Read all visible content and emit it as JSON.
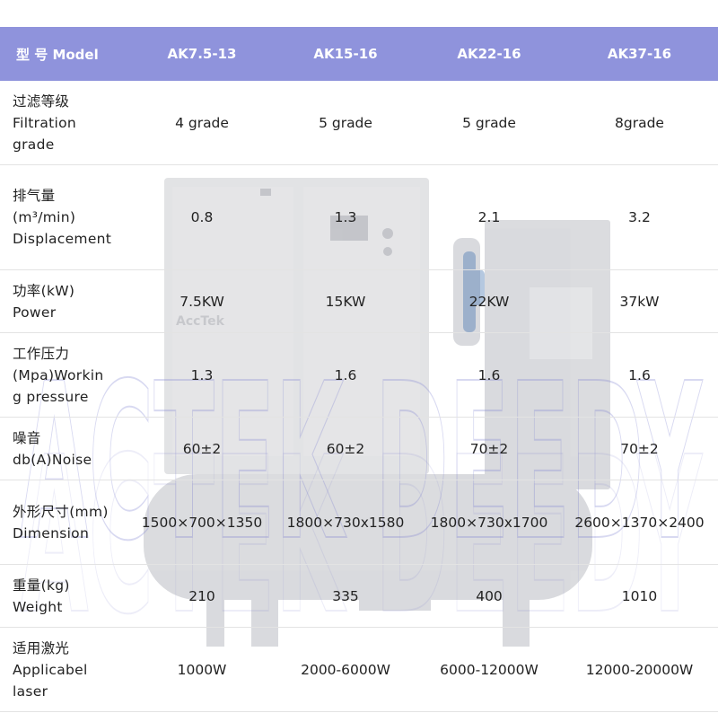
{
  "header": {
    "label": "型 号 Model",
    "models": [
      "AK7.5-13",
      "AK15-16",
      "AK22-16",
      "AK37-16"
    ]
  },
  "rows": [
    {
      "label": "过滤等级\nFiltration\ngrade",
      "values": [
        "4 grade",
        "5 grade",
        "5 grade",
        "8grade"
      ]
    },
    {
      "label": "排气量\n(m³/min)\nDisplacement",
      "values": [
        "0.8",
        "1.3",
        "2.1",
        "3.2"
      ]
    },
    {
      "label": "功率(kW)\nPower",
      "values": [
        "7.5KW",
        "15KW",
        "22KW",
        "37kW"
      ]
    },
    {
      "label": "工作压力\n(Mpa)Workin\ng pressure",
      "values": [
        "1.3",
        "1.6",
        "1.6",
        "1.6"
      ]
    },
    {
      "label": "噪音\ndb(A)Noise",
      "values": [
        "60±2",
        "60±2",
        "70±2",
        "70±2"
      ]
    },
    {
      "label": "外形尺寸(mm)\nDimension",
      "values": [
        "1500×700×1350",
        "1800×730x1580",
        "1800×730x1700",
        "2600×1370×2400"
      ]
    },
    {
      "label": "重量(kg)\nWeight",
      "values": [
        "210",
        "335",
        "400",
        "1010"
      ]
    },
    {
      "label": "适用激光\nApplicabel\nlaser",
      "values": [
        "1000W",
        "2000-6000W",
        "6000-12000W",
        "12000-20000W"
      ]
    }
  ],
  "watermark": {
    "text": "ACTEK DEEDY",
    "logo": "AccTek"
  },
  "colors": {
    "header_bg": "#8f93dc",
    "header_text": "#ffffff",
    "divider": "#e3e3e3"
  }
}
